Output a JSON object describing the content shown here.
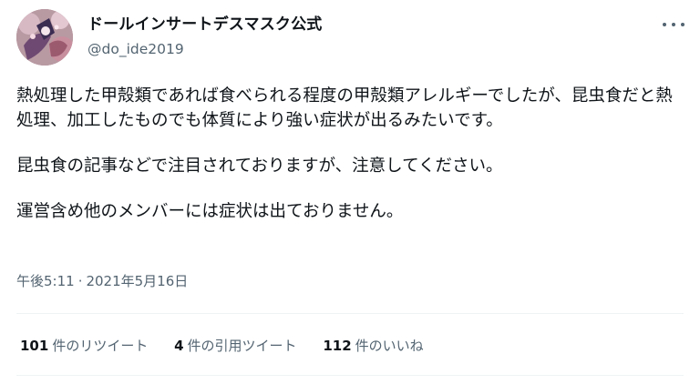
{
  "tweet": {
    "author": {
      "display_name": "ドールインサートデスマスク公式",
      "handle": "@do_ide2019"
    },
    "text": {
      "paragraph1": "熱処理した甲殻類であれば食べられる程度の甲殻類アレルギーでしたが、昆虫食だと熱処理、加工したものでも体質により強い症状が出るみたいです。",
      "paragraph2": "昆虫食の記事などで注目されておりますが、注意してください。",
      "paragraph3": "運営含め他のメンバーには症状は出ておりません。"
    },
    "time": "午後5:11",
    "separator": "·",
    "date": "2021年5月16日",
    "stats": {
      "retweets_count": "101",
      "retweets_label": "件のリツイート",
      "quotes_count": "4",
      "quotes_label": "件の引用ツイート",
      "likes_count": "112",
      "likes_label": "件のいいね"
    },
    "icons": {
      "more": "more-horizontal-icon"
    }
  }
}
